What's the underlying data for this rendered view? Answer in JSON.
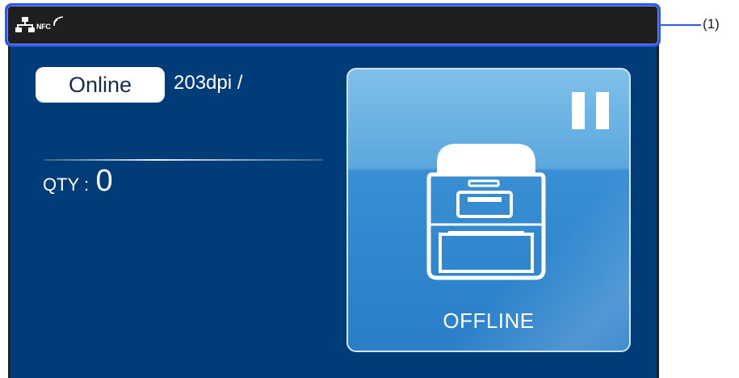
{
  "status_bar": {
    "network_icon": "wired-network-icon",
    "nfc_icon": "nfc-icon",
    "nfc_text": "NFC"
  },
  "callout": {
    "label": "(1)"
  },
  "status": {
    "online_label": "Online",
    "resolution": "203dpi /"
  },
  "quantity": {
    "label": "QTY :",
    "value": "0"
  },
  "main_button": {
    "label": "OFFLINE",
    "pause_icon": "pause-icon",
    "printer_icon": "printer-icon"
  },
  "colors": {
    "screen_bg": "#003c78",
    "status_bar_bg": "#1f1f1f",
    "highlight": "#2f57e8",
    "button_blue": "#3b8fd3"
  }
}
